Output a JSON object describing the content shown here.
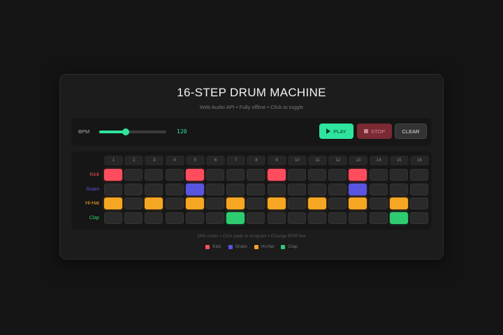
{
  "header": {
    "title": "16-STEP DRUM MACHINE",
    "subtitle": "Web Audio API • Fully offline • Click to toggle"
  },
  "controls": {
    "bpm_label": "BPM",
    "bpm_value": "120",
    "bpm_slider_fraction": 0.4,
    "play_label": "PLAY",
    "stop_label": "STOP",
    "clear_label": "CLEAR"
  },
  "steps": [
    "1",
    "2",
    "3",
    "4",
    "5",
    "6",
    "7",
    "8",
    "9",
    "10",
    "11",
    "12",
    "13",
    "14",
    "15",
    "16"
  ],
  "tracks": [
    {
      "name": "Kick",
      "color": "#ff4d5e",
      "pattern": [
        1,
        0,
        0,
        0,
        1,
        0,
        0,
        0,
        1,
        0,
        0,
        0,
        1,
        0,
        0,
        0
      ]
    },
    {
      "name": "Snare",
      "color": "#5a55e0",
      "pattern": [
        0,
        0,
        0,
        0,
        1,
        0,
        0,
        0,
        0,
        0,
        0,
        0,
        1,
        0,
        0,
        0
      ]
    },
    {
      "name": "Hi-Hat",
      "color": "#f5a623",
      "pattern": [
        1,
        0,
        1,
        0,
        1,
        0,
        1,
        0,
        1,
        0,
        1,
        0,
        1,
        0,
        1,
        0
      ]
    },
    {
      "name": "Clap",
      "color": "#2ecc71",
      "pattern": [
        0,
        0,
        0,
        0,
        0,
        0,
        1,
        0,
        0,
        0,
        0,
        0,
        0,
        0,
        1,
        0
      ]
    }
  ],
  "footer": {
    "hint": "16th notes • Click pads to program • Change BPM live"
  },
  "legend": [
    {
      "label": "Kick",
      "color": "#ff4d5e"
    },
    {
      "label": "Snare",
      "color": "#5a55e0"
    },
    {
      "label": "Hi-Hat",
      "color": "#f5a623"
    },
    {
      "label": "Clap",
      "color": "#2ecc71"
    }
  ]
}
